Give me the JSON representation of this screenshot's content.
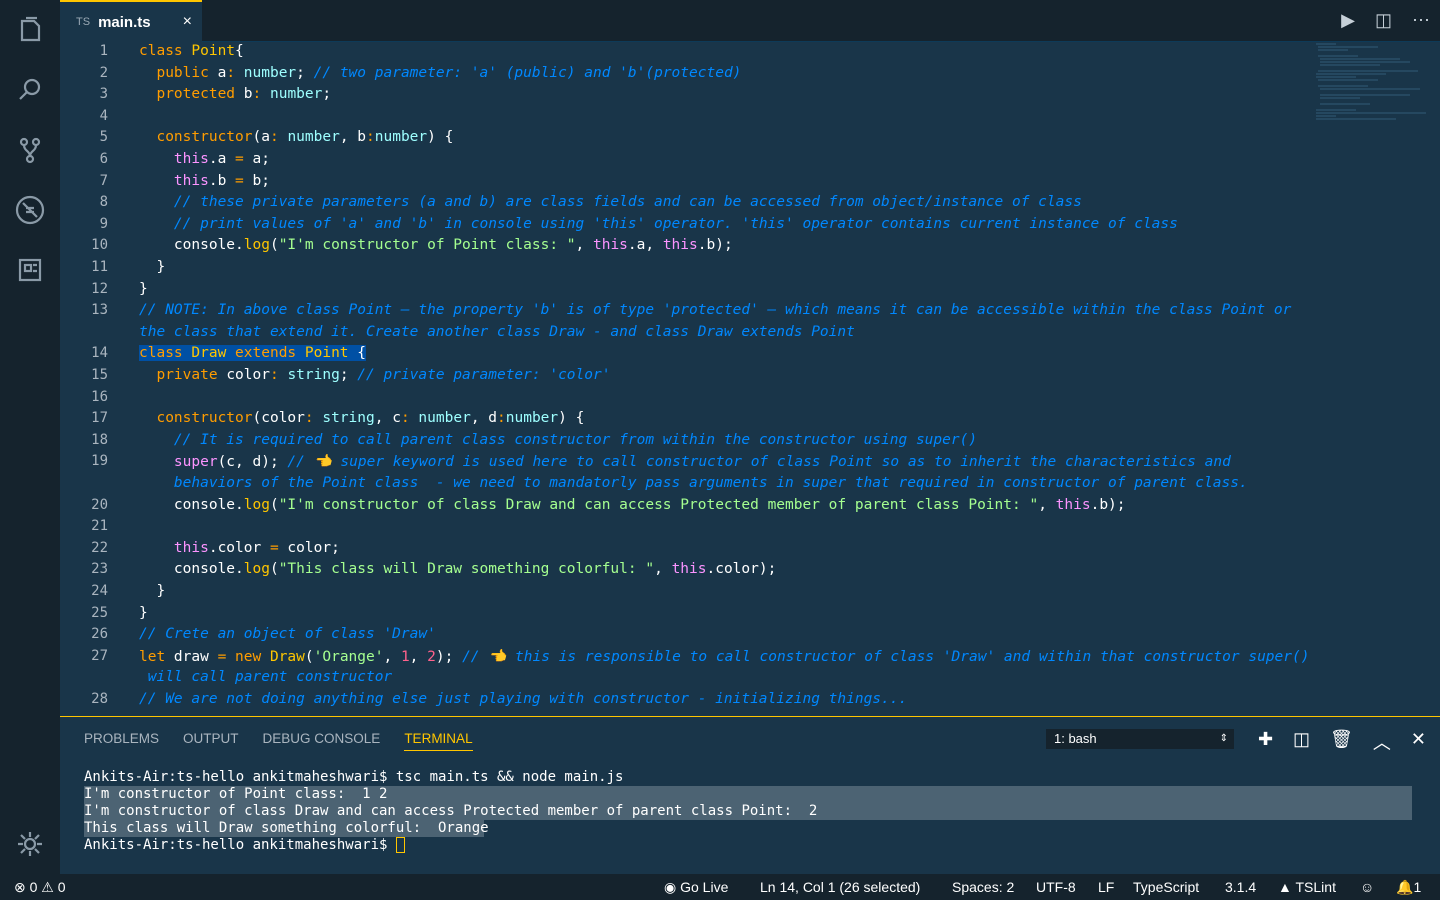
{
  "tab": {
    "lang": "TS",
    "filename": "main.ts",
    "close": "×"
  },
  "editor_lines": [
    {
      "n": "1",
      "segs": [
        [
          "kw",
          "class "
        ],
        [
          "cl",
          "Point"
        ],
        [
          "",
          "{"
        ]
      ]
    },
    {
      "n": "2",
      "segs": [
        [
          "",
          "  "
        ],
        [
          "kw",
          "public "
        ],
        [
          "",
          "a"
        ],
        [
          "kw",
          ": "
        ],
        [
          "ty",
          "number"
        ],
        [
          "",
          "; "
        ],
        [
          "cm",
          "// two parameter: 'a' (public) and 'b'(protected)"
        ]
      ]
    },
    {
      "n": "3",
      "segs": [
        [
          "",
          "  "
        ],
        [
          "kw",
          "protected "
        ],
        [
          "",
          "b"
        ],
        [
          "kw",
          ": "
        ],
        [
          "ty",
          "number"
        ],
        [
          "",
          ";"
        ]
      ]
    },
    {
      "n": "4",
      "segs": [
        [
          "",
          ""
        ]
      ]
    },
    {
      "n": "5",
      "segs": [
        [
          "",
          "  "
        ],
        [
          "kw",
          "constructor"
        ],
        [
          "",
          "(a"
        ],
        [
          "kw",
          ": "
        ],
        [
          "ty",
          "number"
        ],
        [
          "",
          ", b"
        ],
        [
          "kw",
          ":"
        ],
        [
          "ty",
          "number"
        ],
        [
          "",
          ") {"
        ]
      ]
    },
    {
      "n": "6",
      "segs": [
        [
          "",
          "    "
        ],
        [
          "th",
          "this"
        ],
        [
          "",
          ".a "
        ],
        [
          "kw",
          "= "
        ],
        [
          "",
          "a;"
        ]
      ]
    },
    {
      "n": "7",
      "segs": [
        [
          "",
          "    "
        ],
        [
          "th",
          "this"
        ],
        [
          "",
          ".b "
        ],
        [
          "kw",
          "= "
        ],
        [
          "",
          "b;"
        ]
      ]
    },
    {
      "n": "8",
      "segs": [
        [
          "",
          "    "
        ],
        [
          "cm",
          "// these private parameters (a and b) are class fields and can be accessed from object/instance of class"
        ]
      ]
    },
    {
      "n": "9",
      "segs": [
        [
          "",
          "    "
        ],
        [
          "cm",
          "// print values of 'a' and 'b' in console using 'this' operator. 'this' operator contains current instance of class"
        ]
      ]
    },
    {
      "n": "10",
      "segs": [
        [
          "",
          "    console."
        ],
        [
          "fn",
          "log"
        ],
        [
          "",
          "("
        ],
        [
          "st",
          "\"I'm constructor of Point class: \""
        ],
        [
          "",
          ", "
        ],
        [
          "th",
          "this"
        ],
        [
          "",
          ".a, "
        ],
        [
          "th",
          "this"
        ],
        [
          "",
          ".b);"
        ]
      ]
    },
    {
      "n": "11",
      "segs": [
        [
          "",
          "  }"
        ]
      ]
    },
    {
      "n": "12",
      "segs": [
        [
          "",
          "}"
        ]
      ]
    },
    {
      "n": "13",
      "segs": [
        [
          "cm",
          "// NOTE: In above class Point — the property 'b' is of type 'protected' — which means it can be accessible within the class Point or"
        ]
      ]
    },
    {
      "n": "",
      "segs": [
        [
          "cm",
          "the class that extend it. Create another class Draw - and class Draw extends Point"
        ]
      ]
    },
    {
      "n": "14",
      "segs": [
        [
          "kw",
          "class "
        ],
        [
          "cl",
          "Draw "
        ],
        [
          "kw",
          "extends "
        ],
        [
          "cl",
          "Point "
        ],
        [
          "",
          "{"
        ]
      ]
    },
    {
      "n": "15",
      "segs": [
        [
          "",
          "  "
        ],
        [
          "kw",
          "private "
        ],
        [
          "",
          "color"
        ],
        [
          "kw",
          ": "
        ],
        [
          "ty",
          "string"
        ],
        [
          "",
          "; "
        ],
        [
          "cm",
          "// private parameter: 'color'"
        ]
      ]
    },
    {
      "n": "16",
      "segs": [
        [
          "",
          ""
        ]
      ]
    },
    {
      "n": "17",
      "segs": [
        [
          "",
          "  "
        ],
        [
          "kw",
          "constructor"
        ],
        [
          "",
          "(color"
        ],
        [
          "kw",
          ": "
        ],
        [
          "ty",
          "string"
        ],
        [
          "",
          ", c"
        ],
        [
          "kw",
          ": "
        ],
        [
          "ty",
          "number"
        ],
        [
          "",
          ", d"
        ],
        [
          "kw",
          ":"
        ],
        [
          "ty",
          "number"
        ],
        [
          "",
          ") {"
        ]
      ]
    },
    {
      "n": "18",
      "segs": [
        [
          "",
          "    "
        ],
        [
          "cm",
          "// It is required to call parent class constructor from within the constructor using super()"
        ]
      ]
    },
    {
      "n": "19",
      "segs": [
        [
          "",
          "    "
        ],
        [
          "th",
          "super"
        ],
        [
          "",
          "(c, d); "
        ],
        [
          "cm",
          "// 👈 super keyword is used here to call constructor of class Point so as to inherit the characteristics and"
        ]
      ]
    },
    {
      "n": "",
      "segs": [
        [
          "",
          "    "
        ],
        [
          "cm",
          "behaviors of the Point class  - we need to mandatorly pass arguments in super that required in constructor of parent class."
        ]
      ]
    },
    {
      "n": "20",
      "segs": [
        [
          "",
          "    console."
        ],
        [
          "fn",
          "log"
        ],
        [
          "",
          "("
        ],
        [
          "st",
          "\"I'm constructor of class Draw and can access Protected member of parent class Point: \""
        ],
        [
          "",
          ", "
        ],
        [
          "th",
          "this"
        ],
        [
          "",
          ".b);"
        ]
      ]
    },
    {
      "n": "21",
      "segs": [
        [
          "",
          ""
        ]
      ]
    },
    {
      "n": "22",
      "segs": [
        [
          "",
          "    "
        ],
        [
          "th",
          "this"
        ],
        [
          "",
          ".color "
        ],
        [
          "kw",
          "= "
        ],
        [
          "",
          "color;"
        ]
      ]
    },
    {
      "n": "23",
      "segs": [
        [
          "",
          "    console."
        ],
        [
          "fn",
          "log"
        ],
        [
          "",
          "("
        ],
        [
          "st",
          "\"This class will Draw something colorful: \""
        ],
        [
          "",
          ", "
        ],
        [
          "th",
          "this"
        ],
        [
          "",
          ".color);"
        ]
      ]
    },
    {
      "n": "24",
      "segs": [
        [
          "",
          "  }"
        ]
      ]
    },
    {
      "n": "25",
      "segs": [
        [
          "",
          "}"
        ]
      ]
    },
    {
      "n": "26",
      "segs": [
        [
          "cm",
          "// Crete an object of class 'Draw'"
        ]
      ]
    },
    {
      "n": "27",
      "segs": [
        [
          "kw",
          "let "
        ],
        [
          "",
          "draw "
        ],
        [
          "kw",
          "= new "
        ],
        [
          "fn",
          "Draw"
        ],
        [
          "",
          "("
        ],
        [
          "st",
          "'Orange'"
        ],
        [
          "",
          ", "
        ],
        [
          "nu",
          "1"
        ],
        [
          "",
          ", "
        ],
        [
          "nu",
          "2"
        ],
        [
          "",
          "); "
        ],
        [
          "cm",
          "// 👈 this is responsible to call constructor of class 'Draw' and within that constructor super()"
        ]
      ]
    },
    {
      "n": "",
      "segs": [
        [
          "cm",
          " will call parent constructor"
        ]
      ]
    },
    {
      "n": "28",
      "segs": [
        [
          "cm",
          "// We are not doing anything else just playing with constructor - initializing things..."
        ]
      ]
    }
  ],
  "panel": {
    "tabs": [
      "PROBLEMS",
      "OUTPUT",
      "DEBUG CONSOLE",
      "TERMINAL"
    ],
    "active_tab": "TERMINAL",
    "shell": "1: bash",
    "terminal_lines": [
      "Ankits-Air:ts-hello ankitmaheshwari$ tsc main.ts && node main.js",
      "I'm constructor of Point class:  1 2",
      "I'm constructor of class Draw and can access Protected member of parent class Point:  2",
      "This class will Draw something colorful:  Orange",
      "Ankits-Air:ts-hello ankitmaheshwari$ "
    ]
  },
  "status": {
    "errors": "0",
    "warnings": "0",
    "golive": "Go Live",
    "position": "Ln 14, Col 1 (26 selected)",
    "spaces": "Spaces: 2",
    "encoding": "UTF-8",
    "eol": "LF",
    "language": "TypeScript",
    "version": "3.1.4",
    "lint": "TSLint",
    "notifications": "1"
  }
}
